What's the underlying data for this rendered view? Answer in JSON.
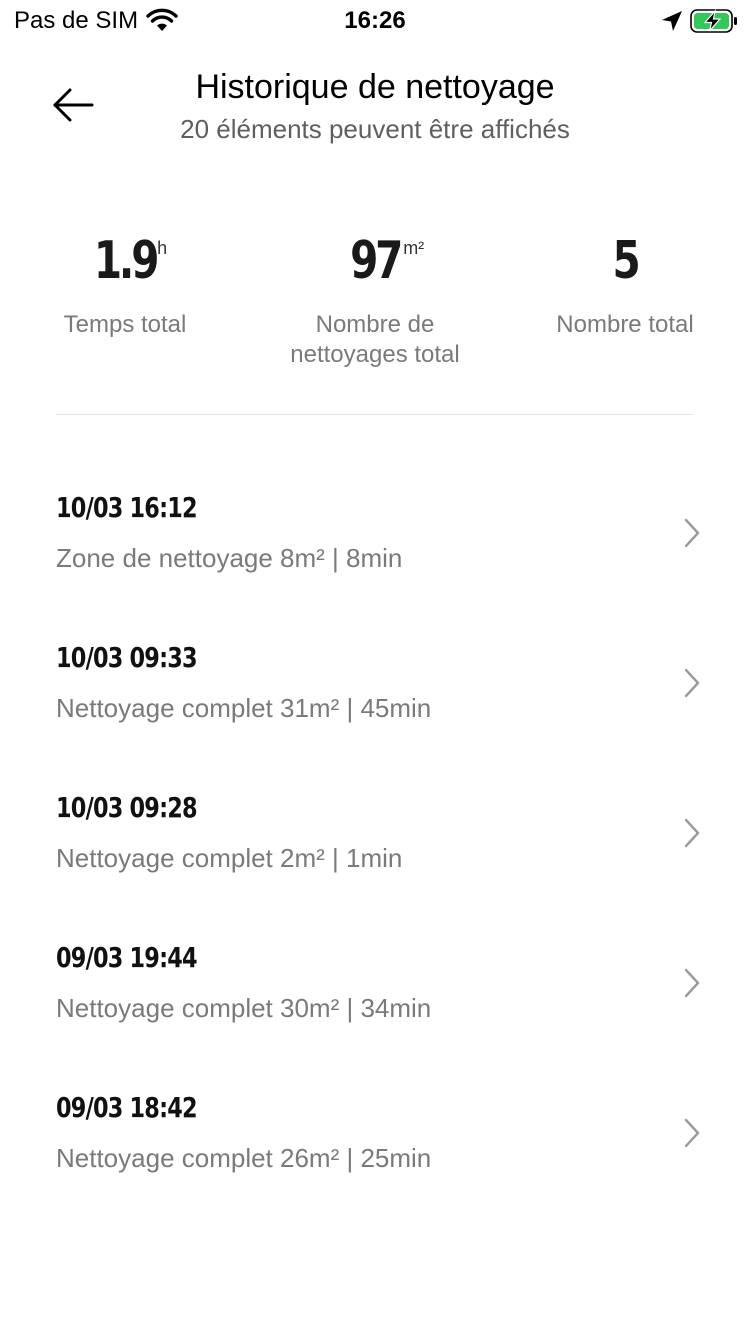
{
  "status_bar": {
    "carrier": "Pas de SIM",
    "time": "16:26",
    "battery_color": "#34c759"
  },
  "header": {
    "title": "Historique de nettoyage",
    "subtitle": "20 éléments peuvent être affichés"
  },
  "stats": [
    {
      "value": "1.9",
      "unit": "h",
      "label": "Temps total"
    },
    {
      "value": "97",
      "unit": "m²",
      "label": "Nombre de nettoyages total"
    },
    {
      "value": "5",
      "unit": "",
      "label": "Nombre total"
    }
  ],
  "history": [
    {
      "date": "10/03 16:12",
      "detail": "Zone de nettoyage 8m² | 8min"
    },
    {
      "date": "10/03 09:33",
      "detail": "Nettoyage complet 31m² | 45min"
    },
    {
      "date": "10/03 09:28",
      "detail": "Nettoyage complet 2m² | 1min"
    },
    {
      "date": "09/03 19:44",
      "detail": "Nettoyage complet 30m² | 34min"
    },
    {
      "date": "09/03 18:42",
      "detail": "Nettoyage complet 26m² | 25min"
    }
  ],
  "icons": {
    "back": "arrow-left-icon",
    "chevron": "chevron-right-icon",
    "wifi": "wifi-icon",
    "location": "location-arrow-icon",
    "battery": "battery-charging-icon"
  }
}
